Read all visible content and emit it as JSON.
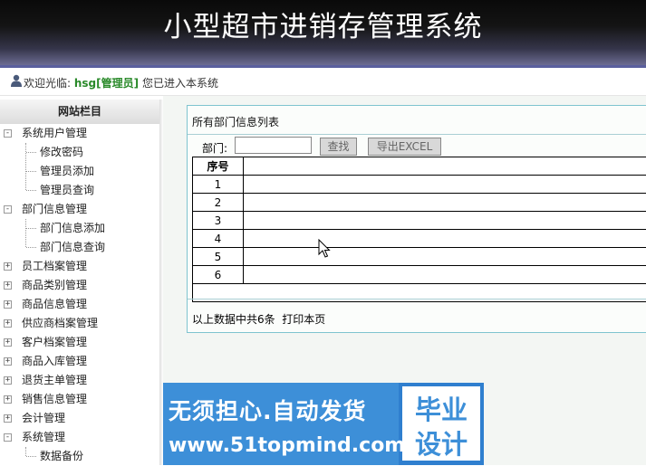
{
  "header": {
    "title": "小型超市进销存管理系统"
  },
  "welcome": {
    "prefix": "欢迎光临:",
    "user": "hsg[管理员]",
    "suffix": "您已进入本系统"
  },
  "sidebar": {
    "title": "网站栏目",
    "items": [
      {
        "label": "系统用户管理",
        "box": "-"
      },
      {
        "label": "修改密码"
      },
      {
        "label": "管理员添加"
      },
      {
        "label": "管理员查询"
      },
      {
        "label": "部门信息管理",
        "box": "-"
      },
      {
        "label": "部门信息添加"
      },
      {
        "label": "部门信息查询"
      },
      {
        "label": "员工档案管理",
        "box": "+"
      },
      {
        "label": "商品类别管理",
        "box": "+"
      },
      {
        "label": "商品信息管理",
        "box": "+"
      },
      {
        "label": "供应商档案管理",
        "box": "+"
      },
      {
        "label": "客户档案管理",
        "box": "+"
      },
      {
        "label": "商品入库管理",
        "box": "+"
      },
      {
        "label": "退货主单管理",
        "box": "+"
      },
      {
        "label": "销售信息管理",
        "box": "+"
      },
      {
        "label": "会计管理",
        "box": "+"
      },
      {
        "label": "系统管理",
        "box": "-"
      },
      {
        "label": "数据备份"
      }
    ]
  },
  "panel": {
    "title": "所有部门信息列表",
    "search_label": "部门:",
    "dept_value": "",
    "search_button": "查找",
    "export_button": "导出EXCEL",
    "table": {
      "header_index": "序号",
      "rows": [
        "1",
        "2",
        "3",
        "4",
        "5",
        "6"
      ]
    },
    "footer": {
      "summary": "以上数据中共6条",
      "print_link": "打印本页"
    }
  },
  "ad": {
    "line1": "无须担心.自动发货",
    "line2": "www.51topmind.com",
    "right_line1": "毕业",
    "right_line2": "设计"
  }
}
